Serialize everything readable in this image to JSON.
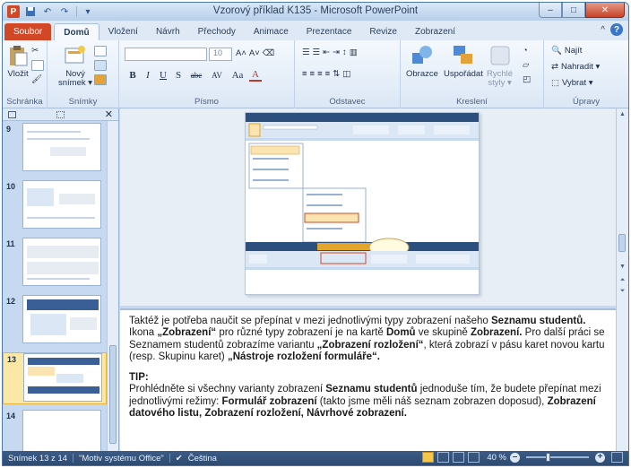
{
  "window": {
    "title": "Vzorový příklad K135 - Microsoft PowerPoint",
    "app_icon": "P",
    "minimize": "–",
    "maximize": "□",
    "close": "✕"
  },
  "qat": {
    "save_icon": "save-icon",
    "undo": "↶",
    "redo": "↷",
    "customize": "▾"
  },
  "tabs": [
    "Soubor",
    "Domů",
    "Vložení",
    "Návrh",
    "Přechody",
    "Animace",
    "Prezentace",
    "Revize",
    "Zobrazení"
  ],
  "active_tab": "Domů",
  "help": "?",
  "collapse": "^",
  "ribbon": {
    "clipboard": {
      "label": "Schránka",
      "paste": "Vložit"
    },
    "slides": {
      "label": "Snímky",
      "new_slide": "Nový",
      "new_slide_2": "snímek ▾"
    },
    "font": {
      "label": "Písmo",
      "font_size": "10",
      "grow": "A˄",
      "shrink": "A˅",
      "bold": "B",
      "italic": "I",
      "underline": "U",
      "shadow": "S",
      "strike": "abc",
      "spacing": "AV",
      "case": "Aa",
      "color": "A"
    },
    "paragraph": {
      "label": "Odstavec"
    },
    "drawing": {
      "label": "Kreslení",
      "shapes": "Obrazce",
      "arrange": "Uspořádat",
      "quick_styles": "Rychlé",
      "quick_styles_2": "styly ▾"
    },
    "editing": {
      "label": "Úpravy",
      "find": "Najít",
      "replace": "Nahradit ▾",
      "select": "Vybrat ▾"
    }
  },
  "slide_thumbnails": [
    {
      "num": "9"
    },
    {
      "num": "10"
    },
    {
      "num": "11"
    },
    {
      "num": "12"
    },
    {
      "num": "13",
      "selected": true
    },
    {
      "num": "14"
    }
  ],
  "notes": {
    "p1_a": "Taktéž je potřeba naučit se přepínat v mezi jednotlivými typy zobrazení našeho ",
    "p1_b": "Seznamu studentů.",
    "p1_c": " Ikona ",
    "p1_d": "„Zobrazení“",
    "p1_e": " pro různé typy zobrazení je na kartě ",
    "p1_f": "Domů",
    "p1_g": " ve skupině ",
    "p1_h": "Zobrazení.",
    "p1_i": " Pro další práci se Seznamem studentů zobrazíme variantu ",
    "p1_j": "„Zobrazení rozložení“",
    "p1_k": ", která zobrazí v pásu karet novou kartu (resp. Skupinu karet) ",
    "p1_l": "„Nástroje rozložení formuláře“.",
    "tip_label": "TIP:",
    "p2_a": "Prohlédněte si všechny varianty zobrazení ",
    "p2_b": "Seznamu studentů",
    "p2_c": " jednoduše tím, že budete přepínat mezi jednotlivými režimy: ",
    "p2_d": "Formulář zobrazení",
    "p2_e": " (takto jsme měli náš seznam zobrazen doposud), ",
    "p2_f": "Zobrazení datového listu, Zobrazení rozložení, Návrhové zobrazení."
  },
  "status": {
    "slide_info": "Snímek 13 z 14",
    "theme": "\"Motiv systému Office\"",
    "language": "Čeština",
    "zoom": "40 %",
    "zoom_out": "–",
    "zoom_in": "+"
  },
  "colors": {
    "file_tab": "#d24726",
    "title_bar": "#c6d9f0",
    "status_bar": "#2e4a70",
    "selection": "#fce8a6"
  }
}
